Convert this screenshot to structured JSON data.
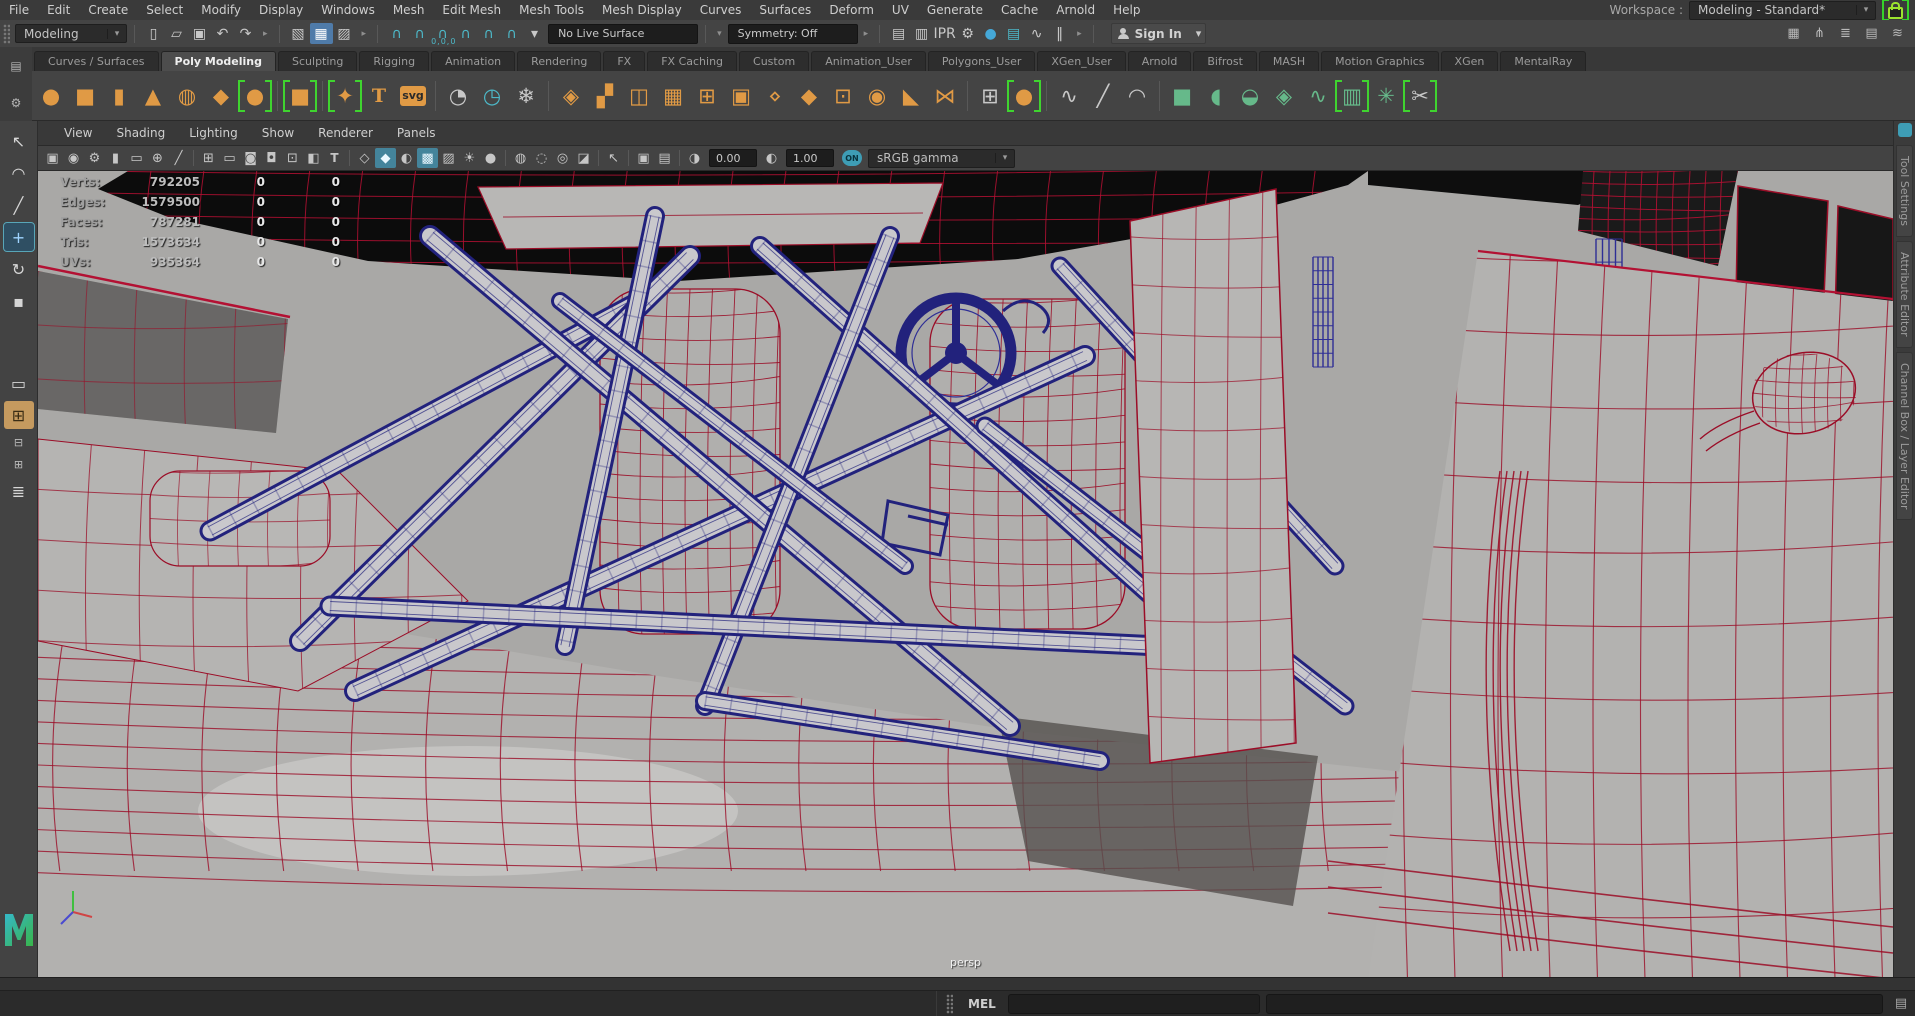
{
  "colors": {
    "wire_red": "#9b0d27",
    "wire_red_bright": "#b31133",
    "cage_navy": "#22227c",
    "cage_navy_light": "#2e2e96",
    "body_gray": "#b2b1af",
    "viewport_bg": "#a9a8a6",
    "accent_orange": "#e09a45",
    "accent_green": "#66b98a",
    "accent_teal": "#4db8c8",
    "active_blue": "#4f7ba9",
    "highlight_green": "#35d22a"
  },
  "ui": {
    "chevron": "▾",
    "chevron_right": "▸"
  },
  "menu_bar": {
    "items": [
      "File",
      "Edit",
      "Create",
      "Select",
      "Modify",
      "Display",
      "Windows",
      "Mesh",
      "Edit Mesh",
      "Mesh Tools",
      "Mesh Display",
      "Curves",
      "Surfaces",
      "Deform",
      "UV",
      "Generate",
      "Cache",
      "Arnold",
      "Help"
    ],
    "workspace_label": "Workspace :",
    "workspace_value": "Modeling - Standard*"
  },
  "status_line": {
    "mode": "Modeling",
    "file_icons": [
      {
        "name": "new-scene-icon",
        "glyph": "▯",
        "cls": "w"
      },
      {
        "name": "open-scene-icon",
        "glyph": "▱",
        "cls": "w"
      },
      {
        "name": "save-scene-icon",
        "glyph": "▣",
        "cls": "w"
      },
      {
        "name": "undo-icon",
        "glyph": "↶",
        "cls": "w"
      },
      {
        "name": "redo-icon",
        "glyph": "↷",
        "cls": "w"
      }
    ],
    "selection_icons": [
      {
        "name": "select-hierarchy-icon",
        "glyph": "▧",
        "cls": "w"
      },
      {
        "name": "select-object-icon",
        "glyph": "▦",
        "cls": "w",
        "active": true
      },
      {
        "name": "select-component-icon",
        "glyph": "▨",
        "cls": "w"
      }
    ],
    "snap_icons": [
      {
        "name": "snap-grid-icon",
        "glyph": "∩",
        "cls": "t"
      },
      {
        "name": "snap-curve-icon",
        "glyph": "∩",
        "cls": "t"
      },
      {
        "name": "snap-point-icon",
        "glyph": "∩",
        "cls": "t"
      },
      {
        "name": "snap-projected-center-icon",
        "glyph": "∩",
        "cls": "t"
      },
      {
        "name": "snap-view-plane-icon",
        "glyph": "∩",
        "cls": "t"
      },
      {
        "name": "make-live-icon",
        "glyph": "∩",
        "cls": "t"
      },
      {
        "name": "snap-options-chevron-icon",
        "glyph": "▾",
        "cls": "w"
      }
    ],
    "snap_coords": "0,0,0",
    "live_surface": "No Live Surface",
    "symmetry": "Symmetry: Off",
    "render_icons": [
      {
        "name": "render-view-icon",
        "glyph": "▤",
        "cls": "w"
      },
      {
        "name": "render-current-frame-icon",
        "glyph": "▥",
        "cls": "w"
      },
      {
        "name": "ipr-render-icon",
        "glyph": "IPR",
        "cls": "w",
        "txt": true
      },
      {
        "name": "render-settings-icon",
        "glyph": "⚙",
        "cls": "w"
      },
      {
        "name": "hypershade-icon",
        "glyph": "●",
        "cls": "b"
      },
      {
        "name": "render-setup-icon",
        "glyph": "▤",
        "cls": "t"
      },
      {
        "name": "paint-effects-panel-icon",
        "glyph": "∿",
        "cls": "w"
      },
      {
        "name": "pause-viewport-icon",
        "glyph": "‖",
        "cls": "w"
      }
    ],
    "sign_in_label": "Sign In",
    "sidebar_icons": [
      {
        "name": "modeling-toolkit-icon",
        "glyph": "▦"
      },
      {
        "name": "humanik-icon",
        "glyph": "⋔"
      },
      {
        "name": "channel-box-icon",
        "glyph": "≣"
      },
      {
        "name": "attribute-editor-icon",
        "glyph": "▤"
      },
      {
        "name": "layer-editor-icon",
        "glyph": "≋"
      }
    ]
  },
  "shelf": {
    "menu_icon": "▤",
    "gear_icon": "⚙",
    "tabs": [
      {
        "label": "Curves / Surfaces"
      },
      {
        "label": "Poly Modeling",
        "active": true
      },
      {
        "label": "Sculpting"
      },
      {
        "label": "Rigging"
      },
      {
        "label": "Animation"
      },
      {
        "label": "Rendering"
      },
      {
        "label": "FX"
      },
      {
        "label": "FX Caching"
      },
      {
        "label": "Custom"
      },
      {
        "label": "Animation_User"
      },
      {
        "label": "Polygons_User"
      },
      {
        "label": "XGen_User"
      },
      {
        "label": "Arnold"
      },
      {
        "label": "Bifrost"
      },
      {
        "label": "MASH"
      },
      {
        "label": "Motion Graphics"
      },
      {
        "label": "XGen"
      },
      {
        "label": "MentalRay"
      }
    ],
    "icons": [
      {
        "name": "poly-sphere-icon",
        "glyph": "●",
        "cls": "o"
      },
      {
        "name": "poly-cube-icon",
        "glyph": "■",
        "cls": "o"
      },
      {
        "name": "poly-cylinder-icon",
        "glyph": "▮",
        "cls": "o"
      },
      {
        "name": "poly-cone-icon",
        "glyph": "▲",
        "cls": "o"
      },
      {
        "name": "poly-torus-icon",
        "glyph": "◍",
        "cls": "o"
      },
      {
        "name": "poly-plane-icon",
        "glyph": "◆",
        "cls": "o"
      },
      {
        "name": "interactive-sphere-icon",
        "glyph": "●",
        "cls": "o",
        "brk": true
      },
      {
        "sep": true
      },
      {
        "name": "interactive-cube-icon",
        "glyph": "■",
        "cls": "o",
        "brk": true
      },
      {
        "sep": true
      },
      {
        "name": "super-shape-icon",
        "glyph": "✦",
        "cls": "o",
        "brk": true
      },
      {
        "name": "poly-text-icon",
        "glyph": "T",
        "cls": "o",
        "txt": true
      },
      {
        "name": "svg-tool-icon",
        "glyph": "svg",
        "badge": true
      },
      {
        "sep": true
      },
      {
        "name": "sculpt-tool-icon",
        "glyph": "◔",
        "cls": "w"
      },
      {
        "name": "keyframe-clock-icon",
        "glyph": "◷",
        "cls": "t"
      },
      {
        "name": "freeze-transform-icon",
        "glyph": "❄",
        "cls": "w"
      },
      {
        "sep": true
      },
      {
        "name": "combine-icon",
        "glyph": "◈",
        "cls": "o"
      },
      {
        "name": "quad-draw-icon",
        "glyph": "▞",
        "cls": "o"
      },
      {
        "name": "mirror-icon",
        "glyph": "◫",
        "cls": "o"
      },
      {
        "name": "subdivide-icon",
        "glyph": "▦",
        "cls": "o"
      },
      {
        "name": "grid-fill-icon",
        "glyph": "⊞",
        "cls": "o"
      },
      {
        "name": "extrude-icon",
        "glyph": "▣",
        "cls": "o"
      },
      {
        "name": "flatten-icon",
        "glyph": "⋄",
        "cls": "o"
      },
      {
        "name": "smooth-icon",
        "glyph": "◆",
        "cls": "o"
      },
      {
        "name": "border-edge-icon",
        "glyph": "⊡",
        "cls": "o"
      },
      {
        "name": "wheel-projection-icon",
        "glyph": "◉",
        "cls": "o"
      },
      {
        "name": "bevel-icon",
        "glyph": "◣",
        "cls": "o"
      },
      {
        "name": "bridge-icon",
        "glyph": "⋈",
        "cls": "o"
      },
      {
        "sep": true
      },
      {
        "name": "lattice-icon",
        "glyph": "⊞",
        "cls": "w"
      },
      {
        "name": "wrap-deformer-icon",
        "glyph": "●",
        "cls": "o",
        "brk": true
      },
      {
        "sep": true
      },
      {
        "name": "ep-curve-icon",
        "glyph": "∿",
        "cls": "w"
      },
      {
        "name": "pencil-curve-icon",
        "glyph": "╱",
        "cls": "w"
      },
      {
        "name": "three-point-arc-icon",
        "glyph": "◠",
        "cls": "w"
      },
      {
        "sep": true
      },
      {
        "name": "boolean-union-icon",
        "glyph": "■",
        "cls": "g"
      },
      {
        "name": "boolean-difference-icon",
        "glyph": "◖",
        "cls": "g"
      },
      {
        "name": "boolean-intersection-icon",
        "glyph": "◒",
        "cls": "g"
      },
      {
        "name": "remesh-icon",
        "glyph": "◈",
        "cls": "g"
      },
      {
        "name": "retopologize-icon",
        "glyph": "∿",
        "cls": "g"
      },
      {
        "name": "uv-editor-icon",
        "glyph": "▥",
        "cls": "g",
        "brk": true
      },
      {
        "name": "xgen-flower-icon",
        "glyph": "✳",
        "cls": "g"
      },
      {
        "name": "cut-tool-icon",
        "glyph": "✂",
        "cls": "w",
        "brk": true
      }
    ]
  },
  "panel": {
    "menus": [
      "View",
      "Shading",
      "Lighting",
      "Show",
      "Renderer",
      "Panels"
    ],
    "toolbar_icons": [
      {
        "name": "select-camera-icon",
        "glyph": "▣",
        "cls": "w"
      },
      {
        "name": "camera-attributes-icon",
        "glyph": "◉",
        "cls": "w"
      },
      {
        "name": "camera-settings-icon",
        "glyph": "⚙",
        "cls": "w"
      },
      {
        "name": "bookmark-icon",
        "glyph": "▮",
        "cls": "w"
      },
      {
        "name": "image-plane-icon",
        "glyph": "▭",
        "cls": "w"
      },
      {
        "name": "pan-zoom-icon",
        "glyph": "⊕",
        "cls": "w"
      },
      {
        "name": "grease-pencil-icon",
        "glyph": "╱",
        "cls": "w"
      },
      {
        "sep": true
      },
      {
        "name": "grid-icon",
        "glyph": "⊞",
        "cls": "w"
      },
      {
        "name": "film-gate-icon",
        "glyph": "▭",
        "cls": "w"
      },
      {
        "name": "resolution-gate-icon",
        "glyph": "◙",
        "cls": "w"
      },
      {
        "name": "gate-mask-icon",
        "glyph": "◘",
        "cls": "w"
      },
      {
        "name": "field-chart-icon",
        "glyph": "⊡",
        "cls": "w"
      },
      {
        "name": "safe-action-icon",
        "glyph": "◧",
        "cls": "w"
      },
      {
        "name": "safe-title-icon",
        "glyph": "T",
        "cls": "w",
        "txt": true
      },
      {
        "sep": true
      },
      {
        "name": "wireframe-display-icon",
        "glyph": "◇",
        "cls": "w"
      },
      {
        "name": "shaded-display-icon",
        "glyph": "◆",
        "cls": "w",
        "active": true
      },
      {
        "name": "wireframe-on-shaded-icon",
        "glyph": "◐",
        "cls": "w"
      },
      {
        "name": "textured-display-icon",
        "glyph": "▩",
        "cls": "w",
        "active": true
      },
      {
        "name": "use-default-material-icon",
        "glyph": "▨",
        "cls": "w"
      },
      {
        "name": "all-lights-icon",
        "glyph": "☀",
        "cls": "w"
      },
      {
        "name": "shadows-icon",
        "glyph": "●",
        "cls": "w"
      },
      {
        "sep": true
      },
      {
        "name": "occlusion-icon",
        "glyph": "◍",
        "cls": "w"
      },
      {
        "name": "motion-blur-icon",
        "glyph": "◌",
        "cls": "w"
      },
      {
        "name": "multisample-icon",
        "glyph": "◎",
        "cls": "w"
      },
      {
        "name": "depth-peeling-icon",
        "glyph": "◪",
        "cls": "w"
      },
      {
        "sep": true
      },
      {
        "name": "isolate-select-icon",
        "glyph": "↖",
        "cls": "w"
      },
      {
        "sep": true
      },
      {
        "name": "xray-icon",
        "glyph": "▣",
        "cls": "w"
      },
      {
        "name": "xray-joints-icon",
        "glyph": "▤",
        "cls": "w"
      },
      {
        "sep": true
      },
      {
        "name": "exposure-icon",
        "glyph": "◑",
        "cls": "w"
      }
    ],
    "exposure_value": "0.00",
    "gamma_icon": "◐",
    "gamma_value": "1.00",
    "toggle_label": "ON",
    "color_transform": "sRGB gamma"
  },
  "hud": {
    "rows": [
      {
        "label": "Verts:",
        "value": "792205",
        "c1": "0",
        "c2": "0"
      },
      {
        "label": "Edges:",
        "value": "1579500",
        "c1": "0",
        "c2": "0"
      },
      {
        "label": "Faces:",
        "value": "787281",
        "c1": "0",
        "c2": "0"
      },
      {
        "label": "Tris:",
        "value": "1573634",
        "c1": "0",
        "c2": "0"
      },
      {
        "label": "UVs:",
        "value": "935364",
        "c1": "0",
        "c2": "0"
      }
    ]
  },
  "viewport": {
    "camera_label": "persp"
  },
  "toolbox": {
    "tools": [
      {
        "name": "select-tool-icon",
        "glyph": "↖"
      },
      {
        "name": "lasso-tool-icon",
        "glyph": "◠"
      },
      {
        "name": "paint-select-tool-icon",
        "glyph": "╱"
      },
      {
        "name": "move-tool-icon",
        "glyph": "+",
        "active": true
      },
      {
        "name": "rotate-tool-icon",
        "glyph": "↻"
      },
      {
        "name": "scale-tool-icon",
        "glyph": "▪"
      }
    ],
    "layouts": [
      {
        "name": "layout-single-pane-icon",
        "glyph": "▭"
      },
      {
        "name": "layout-four-pane-icon",
        "glyph": "⊞",
        "layout_active": true
      },
      {
        "name": "layout-pane-toggle-a-icon",
        "glyph": "⊟",
        "small": true
      },
      {
        "name": "layout-pane-toggle-b-icon",
        "glyph": "⊞",
        "small": true
      },
      {
        "name": "layout-outliner-icon",
        "glyph": "≣"
      }
    ]
  },
  "sidebar": {
    "tabs": [
      "Tool Settings",
      "Attribute Editor",
      "Channel Box / Layer Editor"
    ]
  },
  "command_line": {
    "label": "MEL"
  }
}
